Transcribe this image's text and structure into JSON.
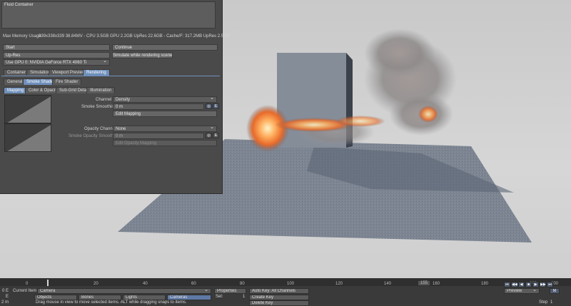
{
  "panel": {
    "title_field": "Fluid Container",
    "memory_label": "Max Memory Usage",
    "memory_value": "339x338x339 38.84MV - CPU 3.5GB GPU 2.2GB UpRes 22.6GB - Cache/F: 317.2MB UpRes 2.5GB",
    "start_button": "Start",
    "continue_button": "Continue",
    "upres_button": "Up-Res",
    "simulate_button": "Simulate while rendering scene",
    "gpu_select": "Use GPU 0: NVIDIA GeForce RTX 4060 Ti",
    "tabs": [
      "Container",
      "Simulation",
      "Viewport Preview",
      "Rendering"
    ],
    "subtabs": [
      "General",
      "Smoke Shader",
      "Fire Shader"
    ],
    "subtabs2": [
      "Mapping",
      "Color & Opacity",
      "Sub-Grid Detail",
      "Illumination"
    ],
    "channel_label": "Channel",
    "channel_value": "Density",
    "smoothing_label": "Smoke Smoothing",
    "smoothing_value": "0 m",
    "edit_mapping": "Edit Mapping",
    "opacity_channel_label": "Opacity Channel",
    "opacity_channel_value": "None",
    "opacity_smoothing_label": "Smoke Opacity Smoothing",
    "opacity_smoothing_value": "0 m",
    "edit_opacity_mapping": "Edit Opacity Mapping",
    "e_label": "E"
  },
  "timeline": {
    "ticks": [
      "0",
      "20",
      "40",
      "60",
      "80",
      "100",
      "120",
      "140",
      "155",
      "160",
      "180",
      "200"
    ],
    "right_value": "200",
    "row1": {
      "left1": "0",
      "left2": "E",
      "current_item_label": "Current Item",
      "current_item": "Camera",
      "properties": "Properties",
      "auto_key": "Auto Key: All Channels",
      "preview": "Preview"
    },
    "row2": {
      "left2": "E",
      "objects": "Objects",
      "bones": "Bones",
      "lights": "Lights",
      "cameras": "Cameras",
      "sel_label": "Sel:",
      "sel_value": "1",
      "create_key": "Create Key"
    },
    "row3": {
      "left1": "2 m",
      "status": "Drag mouse in view to move selected items. ALT while dragging snaps to items.",
      "delete_key": "Delete Key",
      "step_label": "Step",
      "step_value": "1"
    },
    "playback_icons": [
      "⏮",
      "◀◀",
      "◀",
      "■",
      "▶",
      "▶▶",
      "⏭"
    ],
    "end_icon_label": "M"
  }
}
